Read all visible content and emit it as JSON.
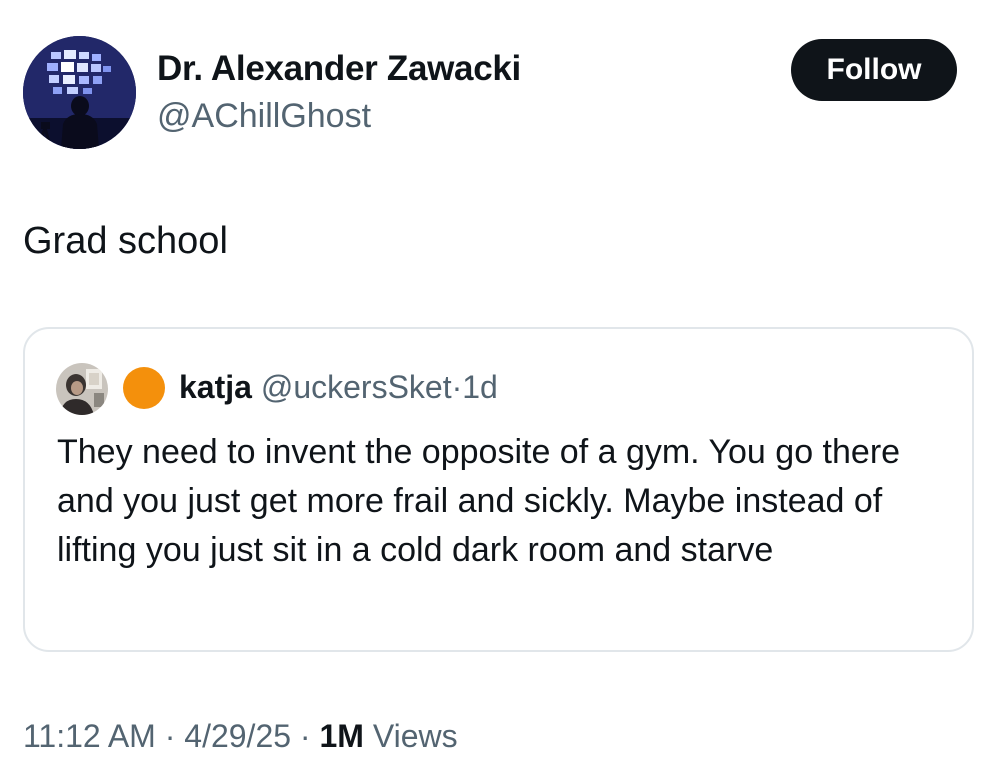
{
  "author": {
    "display_name": "Dr. Alexander Zawacki",
    "handle": "@AChillGhost",
    "avatar_icon": "person-before-monitor-wall-avatar"
  },
  "follow_button": {
    "label": "Follow"
  },
  "tweet": {
    "text": "Grad school"
  },
  "quoted_tweet": {
    "display_name": "katja",
    "name_emoji": "orange-circle-emoji",
    "handle": "@uckersSket",
    "separator": "·",
    "time": "1d",
    "text": "They need to invent the opposite of a gym. You go there and you just get more frail and sickly. Maybe instead of lifting you just sit in a cold dark room and starve"
  },
  "meta": {
    "time": "11:12 AM",
    "separator": "·",
    "date": "4/29/25",
    "views_count": "1M",
    "views_label": "Views"
  },
  "colors": {
    "text_primary": "#0f1419",
    "text_secondary": "#536471",
    "follow_bg": "#0f1419",
    "card_border": "#e1e6ea",
    "emoji_orange": "#f4900c"
  }
}
